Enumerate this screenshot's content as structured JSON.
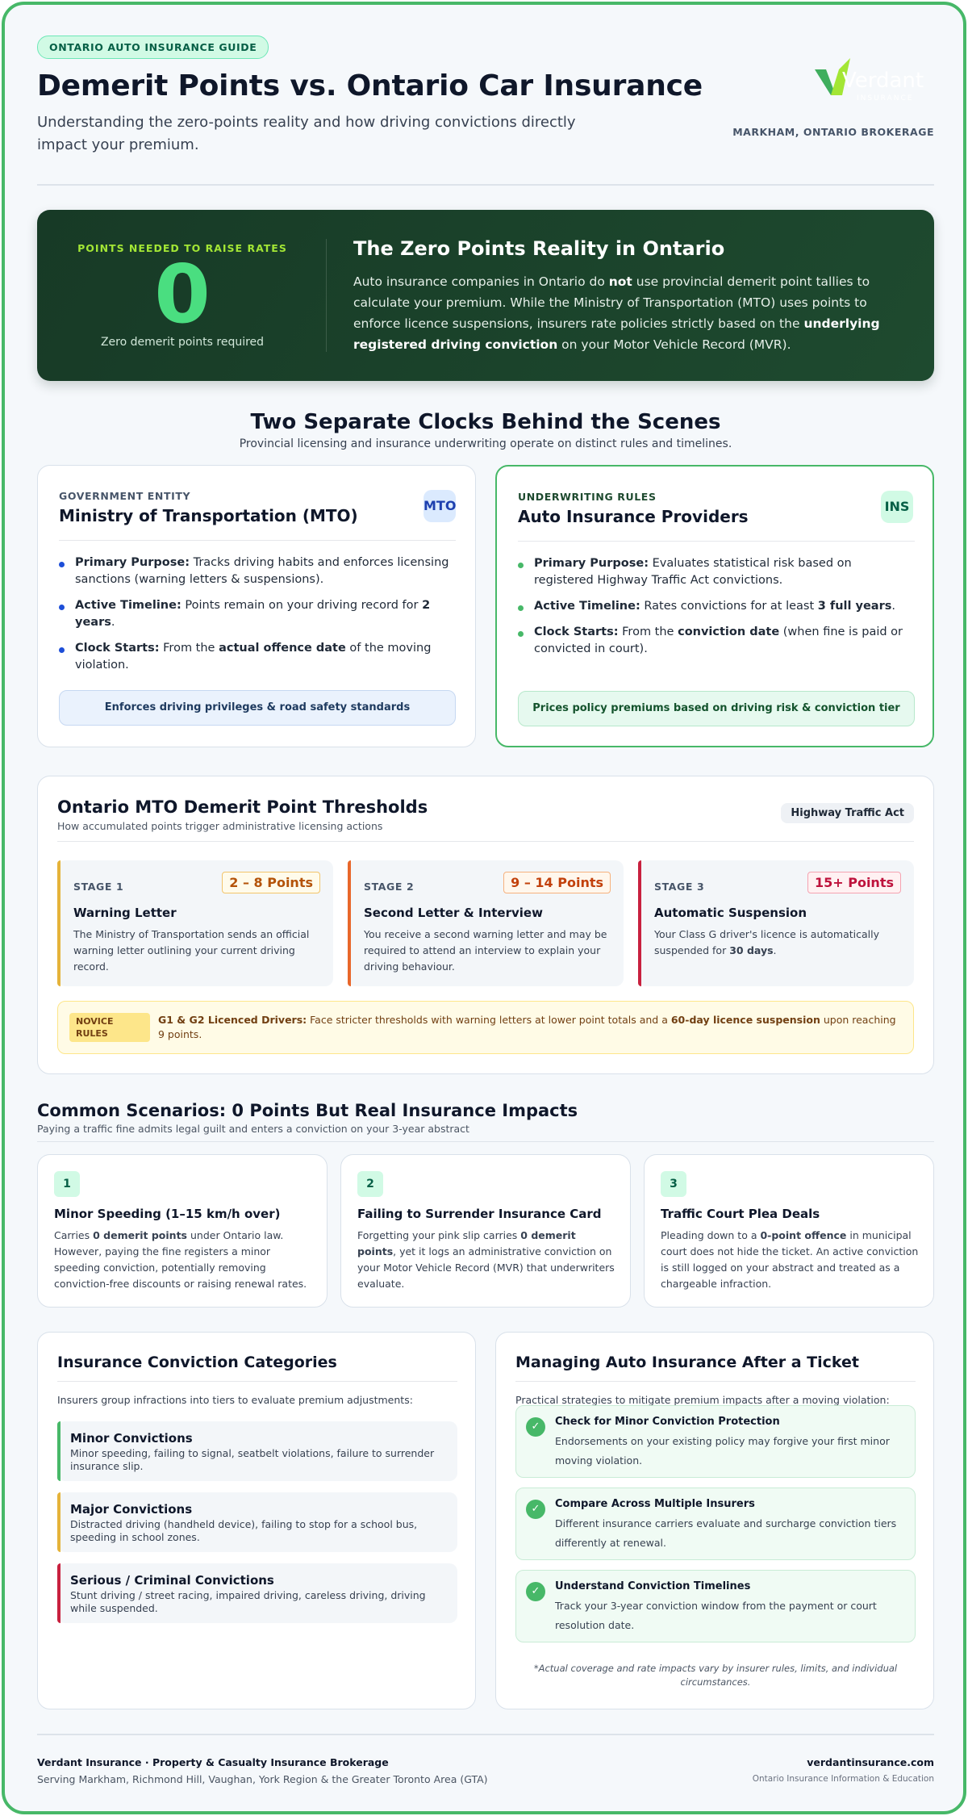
{
  "header": {
    "tag": "ONTARIO AUTO INSURANCE GUIDE",
    "title": "Demerit Points vs. Ontario Car Insurance",
    "subtitle": "Understanding the zero-points reality and how driving convictions directly impact your premium.",
    "logo_text": "Verdant",
    "logo_sub": "INSURANCE",
    "brokerage": "MARKHAM, ONTARIO BROKERAGE",
    "brand_colors": {
      "green": "#47b868",
      "lime": "#a3e635"
    }
  },
  "hero": {
    "kicker": "POINTS NEEDED TO RAISE RATES",
    "number": "0",
    "caption": "Zero demerit points required",
    "title": "The Zero Points Reality in Ontario",
    "body_html": "Auto insurance companies in Ontario do <b>not</b> use provincial demerit point tallies to calculate your premium. While the Ministry of Transportation (MTO) uses points to enforce licence suspensions, insurers rate policies strictly based on the <b>underlying registered driving conviction</b> on your Motor Vehicle Record (MVR)."
  },
  "clocks": {
    "title": "Two Separate Clocks Behind the Scenes",
    "subtitle": "Provincial licensing and insurance underwriting operate on distinct rules and timelines.",
    "mto": {
      "kicker": "GOVERNMENT ENTITY",
      "title": "Ministry of Transportation (MTO)",
      "badge": "MTO",
      "items": [
        "<b>Primary Purpose:</b> Tracks driving habits and enforces licensing sanctions (warning letters &amp; suspensions).",
        "<b>Active Timeline:</b> Points remain on your driving record for <b>2 years</b>.",
        "<b>Clock Starts:</b> From the <b>actual offence date</b> of the moving violation."
      ],
      "footer": "Enforces driving privileges & road safety standards"
    },
    "ins": {
      "kicker": "UNDERWRITING RULES",
      "title": "Auto Insurance Providers",
      "badge": "INS",
      "items": [
        "<b>Primary Purpose:</b> Evaluates statistical risk based on registered Highway Traffic Act convictions.",
        "<b>Active Timeline:</b> Rates convictions for at least <b>3 full years</b>.",
        "<b>Clock Starts:</b> From the <b>conviction date</b> (when fine is paid or convicted in court)."
      ],
      "footer": "Prices policy premiums based on driving risk & conviction tier"
    }
  },
  "thresholds": {
    "title": "Ontario MTO Demerit Point Thresholds",
    "subtitle": "How accumulated points trigger administrative licensing actions",
    "pill": "Highway Traffic Act",
    "stages": [
      {
        "kicker": "STAGE 1",
        "points": "2 – 8 Points",
        "title": "Warning Letter",
        "desc": "The Ministry of Transportation sends an official warning letter outlining your current driving record.",
        "color": "#e5b33a",
        "pts_color": "#b45309",
        "pts_bg": "#fffbeb",
        "pts_border": "#f2c46b"
      },
      {
        "kicker": "STAGE 2",
        "points": "9 – 14 Points",
        "title": "Second Letter & Interview",
        "desc": "You receive a second warning letter and may be required to attend an interview to explain your driving behaviour.",
        "color": "#e8672b",
        "pts_color": "#c2410c",
        "pts_bg": "#fff7ed",
        "pts_border": "#f6b27e"
      },
      {
        "kicker": "STAGE 3",
        "points": "15+ Points",
        "title": "Automatic Suspension",
        "desc_html": "Your Class G driver's licence is automatically suspended for <b>30 days</b>.",
        "color": "#c8213f",
        "pts_color": "#be123c",
        "pts_bg": "#fff1f2",
        "pts_border": "#f5a3b1"
      }
    ],
    "novice": {
      "badge": "NOVICE RULES",
      "text_html": "<b>G1 &amp; G2 Licenced Drivers:</b> Face stricter thresholds with warning letters at lower point totals and a <b>60-day licence suspension</b> upon reaching 9 points."
    }
  },
  "scenarios": {
    "title": "Common Scenarios: 0 Points But Real Insurance Impacts",
    "subtitle": "Paying a traffic fine admits legal guilt and enters a conviction on your 3-year abstract",
    "items": [
      {
        "num": "1",
        "title": "Minor Speeding (1–15 km/h over)",
        "desc_html": "Carries <b>0 demerit points</b> under Ontario law. However, paying the fine registers a minor speeding conviction, potentially removing conviction-free discounts or raising renewal rates."
      },
      {
        "num": "2",
        "title": "Failing to Surrender Insurance Card",
        "desc_html": "Forgetting your pink slip carries <b>0 demerit points</b>, yet it logs an administrative conviction on your Motor Vehicle Record (MVR) that underwriters evaluate."
      },
      {
        "num": "3",
        "title": "Traffic Court Plea Deals",
        "desc_html": "Pleading down to a <b>0-point offence</b> in municipal court does not hide the ticket. An active conviction is still logged on your abstract and treated as a chargeable infraction."
      }
    ]
  },
  "categories": {
    "title": "Insurance Conviction Categories",
    "intro": "Insurers group infractions into tiers to evaluate premium adjustments:",
    "items": [
      {
        "title": "Minor Convictions",
        "desc": "Minor speeding, failing to signal, seatbelt violations, failure to surrender insurance slip.",
        "color": "#47b868"
      },
      {
        "title": "Major Convictions",
        "desc": "Distracted driving (handheld device), failing to stop for a school bus, speeding in school zones.",
        "color": "#e5b33a"
      },
      {
        "title": "Serious / Criminal Convictions",
        "desc": "Stunt driving / street racing, impaired driving, careless driving, driving while suspended.",
        "color": "#c8213f"
      }
    ]
  },
  "managing": {
    "title": "Managing Auto Insurance After a Ticket",
    "intro": "Practical strategies to mitigate premium impacts after a moving violation:",
    "items": [
      {
        "title": "Check for Minor Conviction Protection",
        "desc": "Endorsements on your existing policy may forgive your first minor moving violation."
      },
      {
        "title": "Compare Across Multiple Insurers",
        "desc": "Different insurance carriers evaluate and surcharge conviction tiers differently at renewal."
      },
      {
        "title": "Understand Conviction Timelines",
        "desc": "Track your 3-year conviction window from the payment or court resolution date."
      }
    ],
    "disclaimer": "*Actual coverage and rate impacts vary by insurer rules, limits, and individual circumstances."
  },
  "footer": {
    "left_title": "Verdant Insurance · Property & Casualty Insurance Brokerage",
    "left_sub": "Serving Markham, Richmond Hill, Vaughan, York Region & the Greater Toronto Area (GTA)",
    "right_title": "verdantinsurance.com",
    "right_sub": "Ontario Insurance Information & Education"
  }
}
